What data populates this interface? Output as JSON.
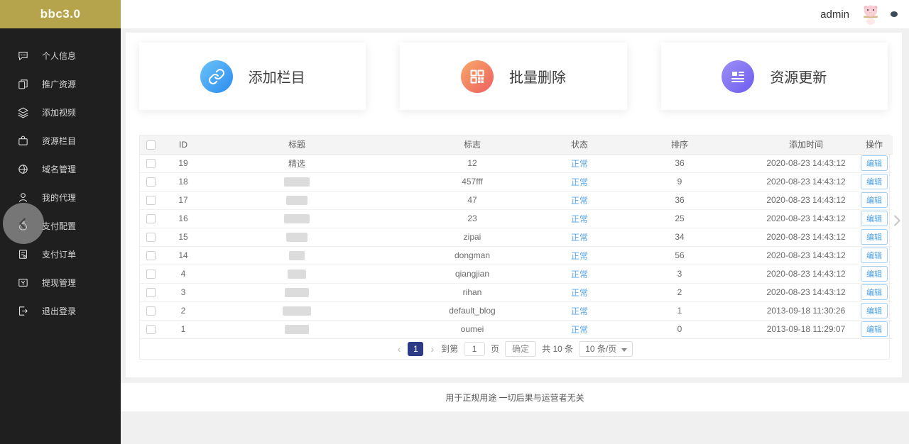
{
  "colors": {
    "gold": "#b5a44b",
    "sidebar_bg": "#1f1f1f",
    "status_blue": "#58a5e8",
    "active_page_bg": "#2d3a85"
  },
  "header": {
    "username": "admin"
  },
  "sidebar": {
    "logo": "bbc3.0",
    "items": [
      {
        "name": "personal-info",
        "icon": "chat",
        "label": "个人信息"
      },
      {
        "name": "promo-resources",
        "icon": "books",
        "label": "推广资源"
      },
      {
        "name": "add-video",
        "icon": "layers",
        "label": "添加视频"
      },
      {
        "name": "resource-columns",
        "icon": "briefcase",
        "label": "资源栏目"
      },
      {
        "name": "domain-management",
        "icon": "globe",
        "label": "域名管理"
      },
      {
        "name": "my-agents",
        "icon": "user",
        "label": "我的代理"
      },
      {
        "name": "payment-config",
        "icon": "moneybag",
        "label": "支付配置"
      },
      {
        "name": "payment-orders",
        "icon": "receipt",
        "label": "支付订单"
      },
      {
        "name": "withdrawal-management",
        "icon": "withdraw",
        "label": "提现管理"
      },
      {
        "name": "logout",
        "icon": "logout",
        "label": "退出登录"
      }
    ]
  },
  "cards": [
    {
      "name": "add-column",
      "icon": "link",
      "label": "添加栏目",
      "color_from": "#6cc3f8",
      "color_to": "#2a8bf0"
    },
    {
      "name": "batch-delete",
      "icon": "qrcode",
      "label": "批量删除",
      "color_from": "#f7a96a",
      "color_to": "#ee5f5f"
    },
    {
      "name": "resource-update",
      "icon": "list",
      "label": "资源更新",
      "color_from": "#9e90f6",
      "color_to": "#6d5cee"
    }
  ],
  "table": {
    "headers": {
      "id": "ID",
      "title": "标题",
      "flag": "标志",
      "status": "状态",
      "sort": "排序",
      "time": "添加时间",
      "action": "操作"
    },
    "edit_label": "编辑",
    "rows": [
      {
        "id": "19",
        "title": "精选",
        "redacted": false,
        "flag": "12",
        "status": "正常",
        "sort": "36",
        "time": "2020-08-23 14:43:12"
      },
      {
        "id": "18",
        "title": "",
        "redacted": true,
        "flag": "457fff",
        "status": "正常",
        "sort": "9",
        "time": "2020-08-23 14:43:12"
      },
      {
        "id": "17",
        "title": "",
        "redacted": true,
        "flag": "47",
        "status": "正常",
        "sort": "36",
        "time": "2020-08-23 14:43:12"
      },
      {
        "id": "16",
        "title": "",
        "redacted": true,
        "flag": "23",
        "status": "正常",
        "sort": "25",
        "time": "2020-08-23 14:43:12"
      },
      {
        "id": "15",
        "title": "",
        "redacted": true,
        "flag": "zipai",
        "status": "正常",
        "sort": "34",
        "time": "2020-08-23 14:43:12"
      },
      {
        "id": "14",
        "title": "",
        "redacted": true,
        "flag": "dongman",
        "status": "正常",
        "sort": "56",
        "time": "2020-08-23 14:43:12"
      },
      {
        "id": "4",
        "title": "",
        "redacted": true,
        "flag": "qiangjian",
        "status": "正常",
        "sort": "3",
        "time": "2020-08-23 14:43:12"
      },
      {
        "id": "3",
        "title": "",
        "redacted": true,
        "flag": "rihan",
        "status": "正常",
        "sort": "2",
        "time": "2020-08-23 14:43:12"
      },
      {
        "id": "2",
        "title": "",
        "redacted": true,
        "flag": "default_blog",
        "status": "正常",
        "sort": "1",
        "time": "2013-09-18 11:30:26"
      },
      {
        "id": "1",
        "title": "",
        "redacted": true,
        "flag": "oumei",
        "status": "正常",
        "sort": "0",
        "time": "2013-09-18 11:29:07"
      }
    ]
  },
  "pagination": {
    "prev": "‹",
    "next": "›",
    "current_page": "1",
    "goto_label": "到第",
    "page_input": "1",
    "page_unit": "页",
    "confirm": "确定",
    "total": "共 10 条",
    "page_size": "10 条/页"
  },
  "footer": {
    "text": "用于正规用途 一切后果与运营者无关"
  }
}
